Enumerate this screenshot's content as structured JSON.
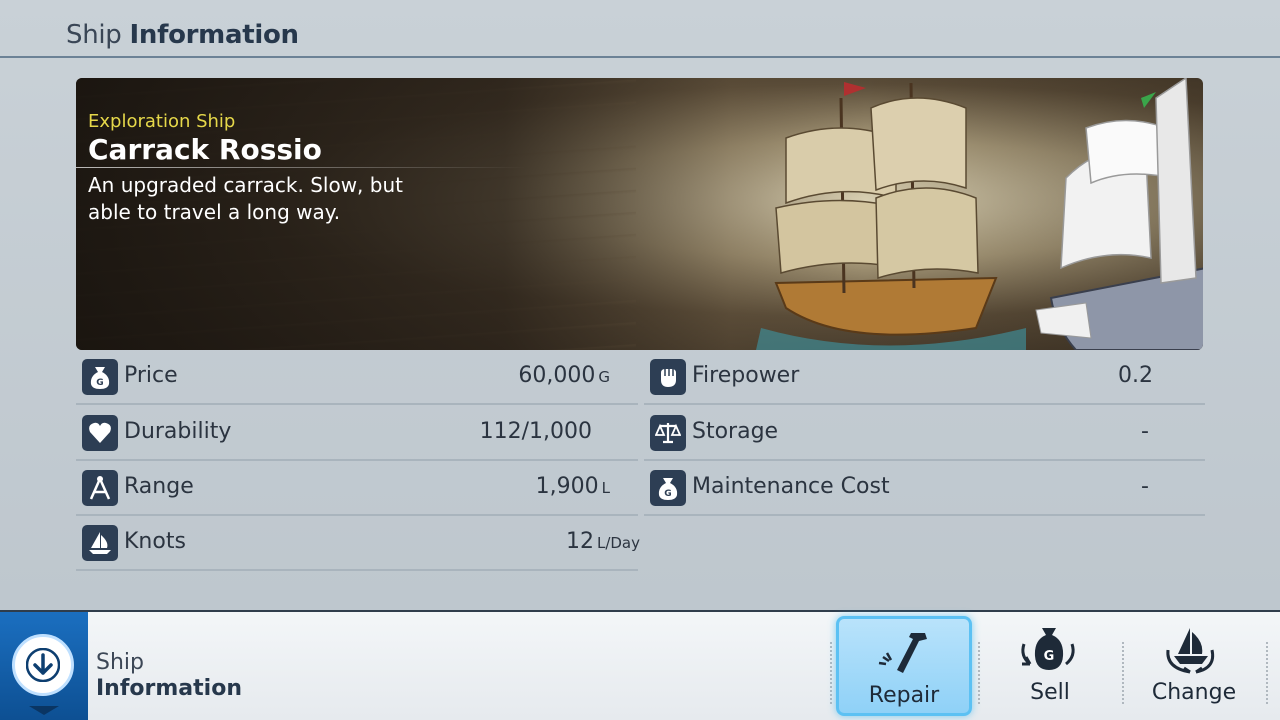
{
  "header": {
    "title_light": "Ship",
    "title_bold": "Information"
  },
  "ship": {
    "type": "Exploration Ship",
    "name": "Carrack Rossio",
    "description": "An upgraded carrack. Slow, but able to travel a long way."
  },
  "stats_left": [
    {
      "label": "Price",
      "value": "60,000",
      "unit": "G",
      "icon": "money-bag-icon"
    },
    {
      "label": "Durability",
      "value": "112/1,000",
      "unit": "",
      "icon": "heart-icon"
    },
    {
      "label": "Range",
      "value": "1,900",
      "unit": "L",
      "icon": "compass-icon"
    },
    {
      "label": "Knots",
      "value": "12",
      "unit": "L/Day",
      "icon": "sail-icon"
    }
  ],
  "stats_right": [
    {
      "label": "Firepower",
      "value": "0.2",
      "unit": "",
      "icon": "fist-icon"
    },
    {
      "label": "Storage",
      "value": "-",
      "unit": "",
      "icon": "scales-icon"
    },
    {
      "label": "Maintenance Cost",
      "value": "-",
      "unit": "",
      "icon": "money-bag-icon"
    }
  ],
  "bottom_bar": {
    "label_line1": "Ship",
    "label_line2": "Information",
    "actions": [
      {
        "label": "Repair",
        "icon": "hammer-icon",
        "active": true
      },
      {
        "label": "Sell",
        "icon": "sell-bag-icon",
        "active": false
      },
      {
        "label": "Change",
        "icon": "change-ship-icon",
        "active": false
      }
    ]
  },
  "colors": {
    "accent_blue": "#1b6fc0",
    "ship_type_yellow": "#e6d84a",
    "icon_navy": "#2d3e54",
    "active_button": "#8fd1f7"
  }
}
